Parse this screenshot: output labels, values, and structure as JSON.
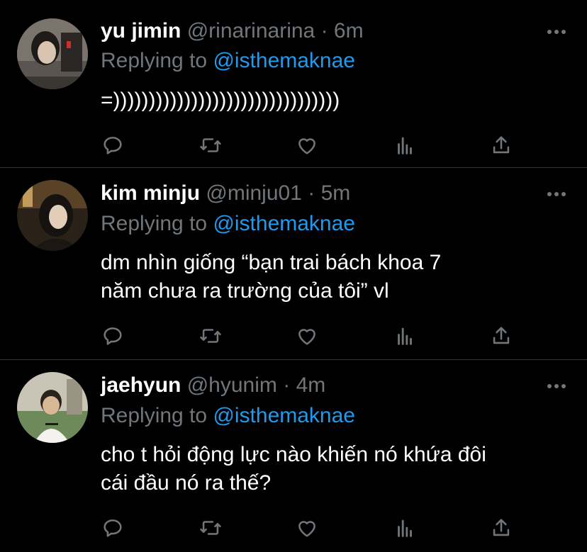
{
  "tweets": [
    {
      "name": "yu jimin",
      "handle": "@rinarinarina",
      "separator": "·",
      "time": "6m",
      "replying_prefix": "Replying to ",
      "replying_to": "@isthemaknae",
      "text": "=))))))))))))))))))))))))))))))))",
      "avatar": "avatar-yu-jimin"
    },
    {
      "name": "kim minju",
      "handle": "@minju01",
      "separator": "·",
      "time": "5m",
      "replying_prefix": "Replying to ",
      "replying_to": "@isthemaknae",
      "text_line1": "dm nhìn giống “bạn trai bách khoa 7",
      "text_line2": "năm chưa ra trường của tôi” vl",
      "avatar": "avatar-kim-minju"
    },
    {
      "name": "jaehyun",
      "handle": "@hyunim",
      "separator": "·",
      "time": "4m",
      "replying_prefix": "Replying to ",
      "replying_to": "@isthemaknae",
      "text_line1": "cho t hỏi động lực nào khiến nó khứa đôi",
      "text_line2": "cái đầu nó ra thế?",
      "avatar": "avatar-jaehyun"
    }
  ],
  "icons": [
    "reply-icon",
    "retweet-icon",
    "like-icon",
    "analytics-icon",
    "share-icon",
    "more-icon"
  ],
  "colors": {
    "background": "#000000",
    "text": "#ffffff",
    "secondary": "#71767b",
    "link": "#1d9bf0",
    "divider": "#2f3336"
  }
}
